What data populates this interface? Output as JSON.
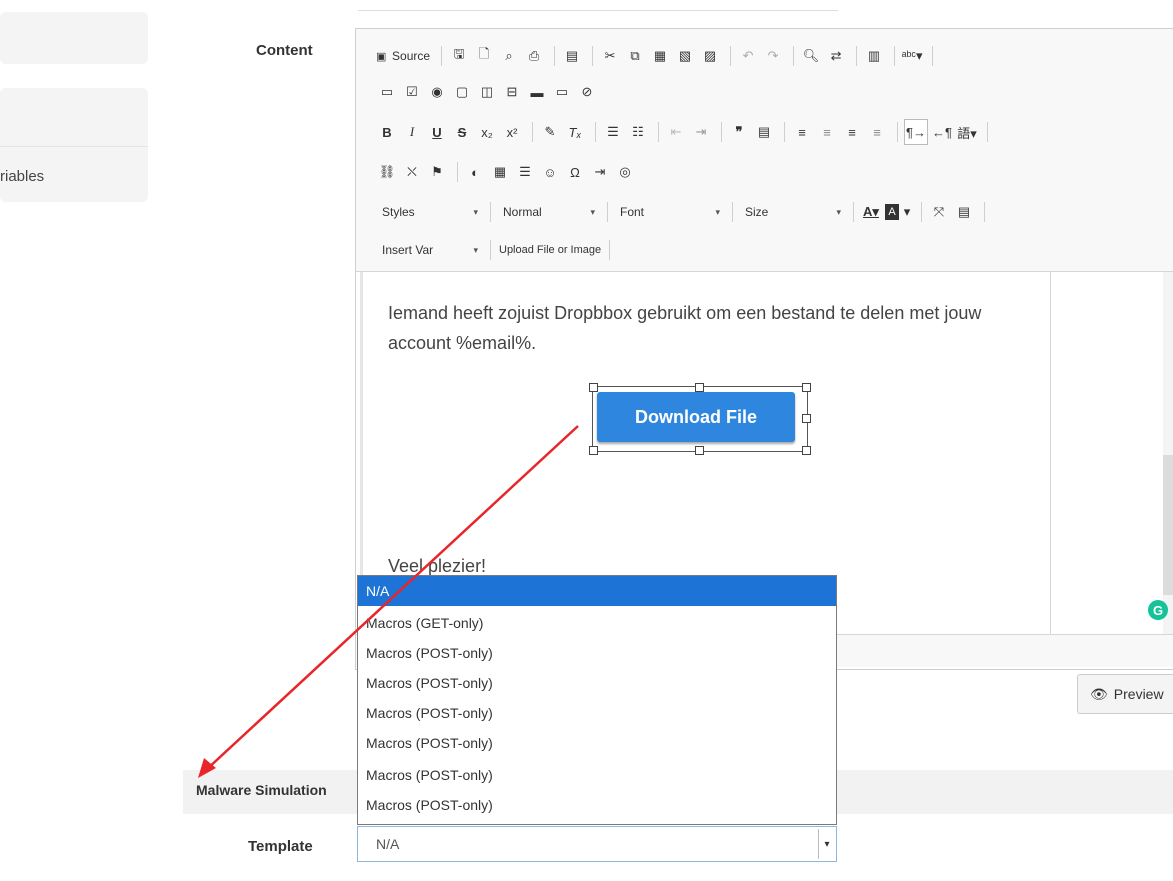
{
  "sidebar": {
    "partial_label": "riables"
  },
  "content_label": "Content",
  "toolbar": {
    "source_label": "Source",
    "row1_icons": [
      "save-icon",
      "new-page-icon",
      "preview-doc-icon",
      "print-icon",
      "templates-icon",
      "cut-icon",
      "copy-icon",
      "paste-icon",
      "paste-text-icon",
      "paste-word-icon",
      "undo-icon",
      "redo-icon",
      "find-icon",
      "replace-icon",
      "select-all-icon",
      "spellcheck-icon"
    ],
    "styles_combo": "Styles",
    "format_combo": "Normal",
    "font_combo": "Font",
    "size_combo": "Size",
    "insert_var_combo": "Insert Var",
    "upload_label": "Upload File or Image"
  },
  "editor": {
    "paragraph": "Iemand heeft zojuist Dropbbox gebruikt om een bestand te delen met jouw account %email%.",
    "download_button": "Download File",
    "closing": "Veel plezier!"
  },
  "preview_button": "Preview",
  "malware_section": {
    "title": "Malware Simulation"
  },
  "template_label": "Template",
  "template_select": {
    "value": "N/A",
    "options": [
      "N/A",
      "Macros (GET-only)",
      "Macros (POST-only)",
      "Macros (POST-only)",
      "Macros (POST-only)",
      "Macros (POST-only)",
      "Macros (POST-only)",
      "Macros (POST-only)"
    ]
  },
  "colors": {
    "selected_option": "#1e73d6",
    "button_blue": "#2f86df",
    "annotation_arrow": "#e8262a"
  }
}
